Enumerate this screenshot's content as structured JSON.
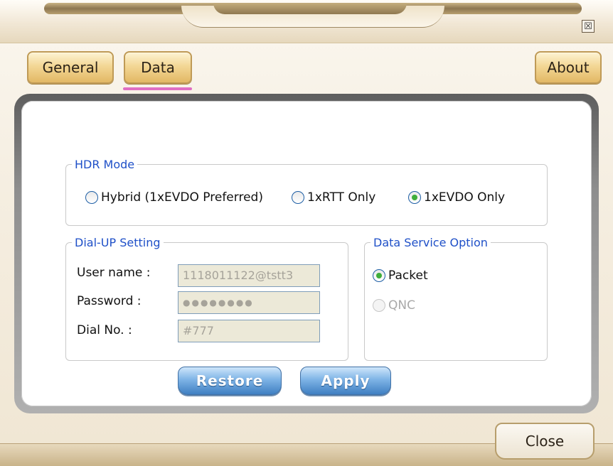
{
  "window": {
    "close_glyph": "☒"
  },
  "tabs": [
    {
      "label": "General"
    },
    {
      "label": "Data",
      "active": true
    },
    {
      "label": "About"
    }
  ],
  "hdr_mode": {
    "legend": "HDR Mode",
    "options": [
      {
        "label": "Hybrid (1xEVDO Preferred)",
        "checked": false
      },
      {
        "label": "1xRTT Only",
        "checked": false
      },
      {
        "label": "1xEVDO Only",
        "checked": true
      }
    ]
  },
  "dialup": {
    "legend": "Dial-UP Setting",
    "user_label": "User name :",
    "user_value": "1118011122@tstt3",
    "password_label": "Password  :",
    "password_value": "●●●●●●●●",
    "dial_label": "Dial No.   :",
    "dial_value": "#777"
  },
  "data_service": {
    "legend": "Data Service Option",
    "options": [
      {
        "label": "Packet",
        "checked": true,
        "enabled": true
      },
      {
        "label": "QNC",
        "checked": false,
        "enabled": false
      }
    ]
  },
  "buttons": {
    "restore": "Restore",
    "apply": "Apply",
    "close": "Close"
  },
  "colors": {
    "legend_blue": "#1f50c8",
    "tab_gold": "#f3d795",
    "active_tab_underline": "#e06ec3",
    "button_blue": "#3f7fc2"
  }
}
